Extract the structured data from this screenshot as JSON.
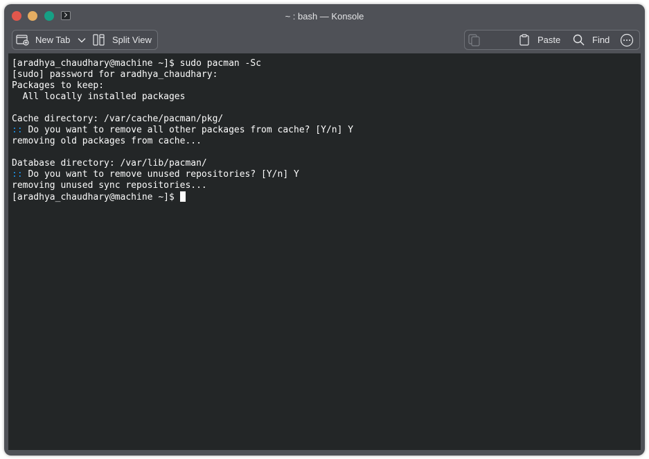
{
  "window": {
    "title": "~ : bash — Konsole"
  },
  "toolbar": {
    "new_tab_label": "New Tab",
    "split_view_label": "Split View",
    "paste_label": "Paste",
    "find_label": "Find"
  },
  "terminal": {
    "lines": [
      {
        "text": "[aradhya_chaudhary@machine ~]$ sudo pacman -Sc"
      },
      {
        "text": "[sudo] password for aradhya_chaudhary:"
      },
      {
        "text": "Packages to keep:"
      },
      {
        "text": "  All locally installed packages"
      },
      {
        "text": ""
      },
      {
        "text": "Cache directory: /var/cache/pacman/pkg/"
      },
      {
        "prefix": "::",
        "text": " Do you want to remove all other packages from cache? [Y/n] Y"
      },
      {
        "text": "removing old packages from cache..."
      },
      {
        "text": ""
      },
      {
        "text": "Database directory: /var/lib/pacman/"
      },
      {
        "prefix": "::",
        "text": " Do you want to remove unused repositories? [Y/n] Y"
      },
      {
        "text": "removing unused sync repositories..."
      }
    ],
    "prompt": "[aradhya_chaudhary@machine ~]$ "
  },
  "colors": {
    "window_bg": "#4f5157",
    "terminal_bg": "#232627",
    "terminal_fg": "#fcfcfc",
    "prompt_marker": "#1d99f3",
    "close": "#e2574c",
    "minimize": "#e4ad62",
    "maximize": "#16a085"
  }
}
